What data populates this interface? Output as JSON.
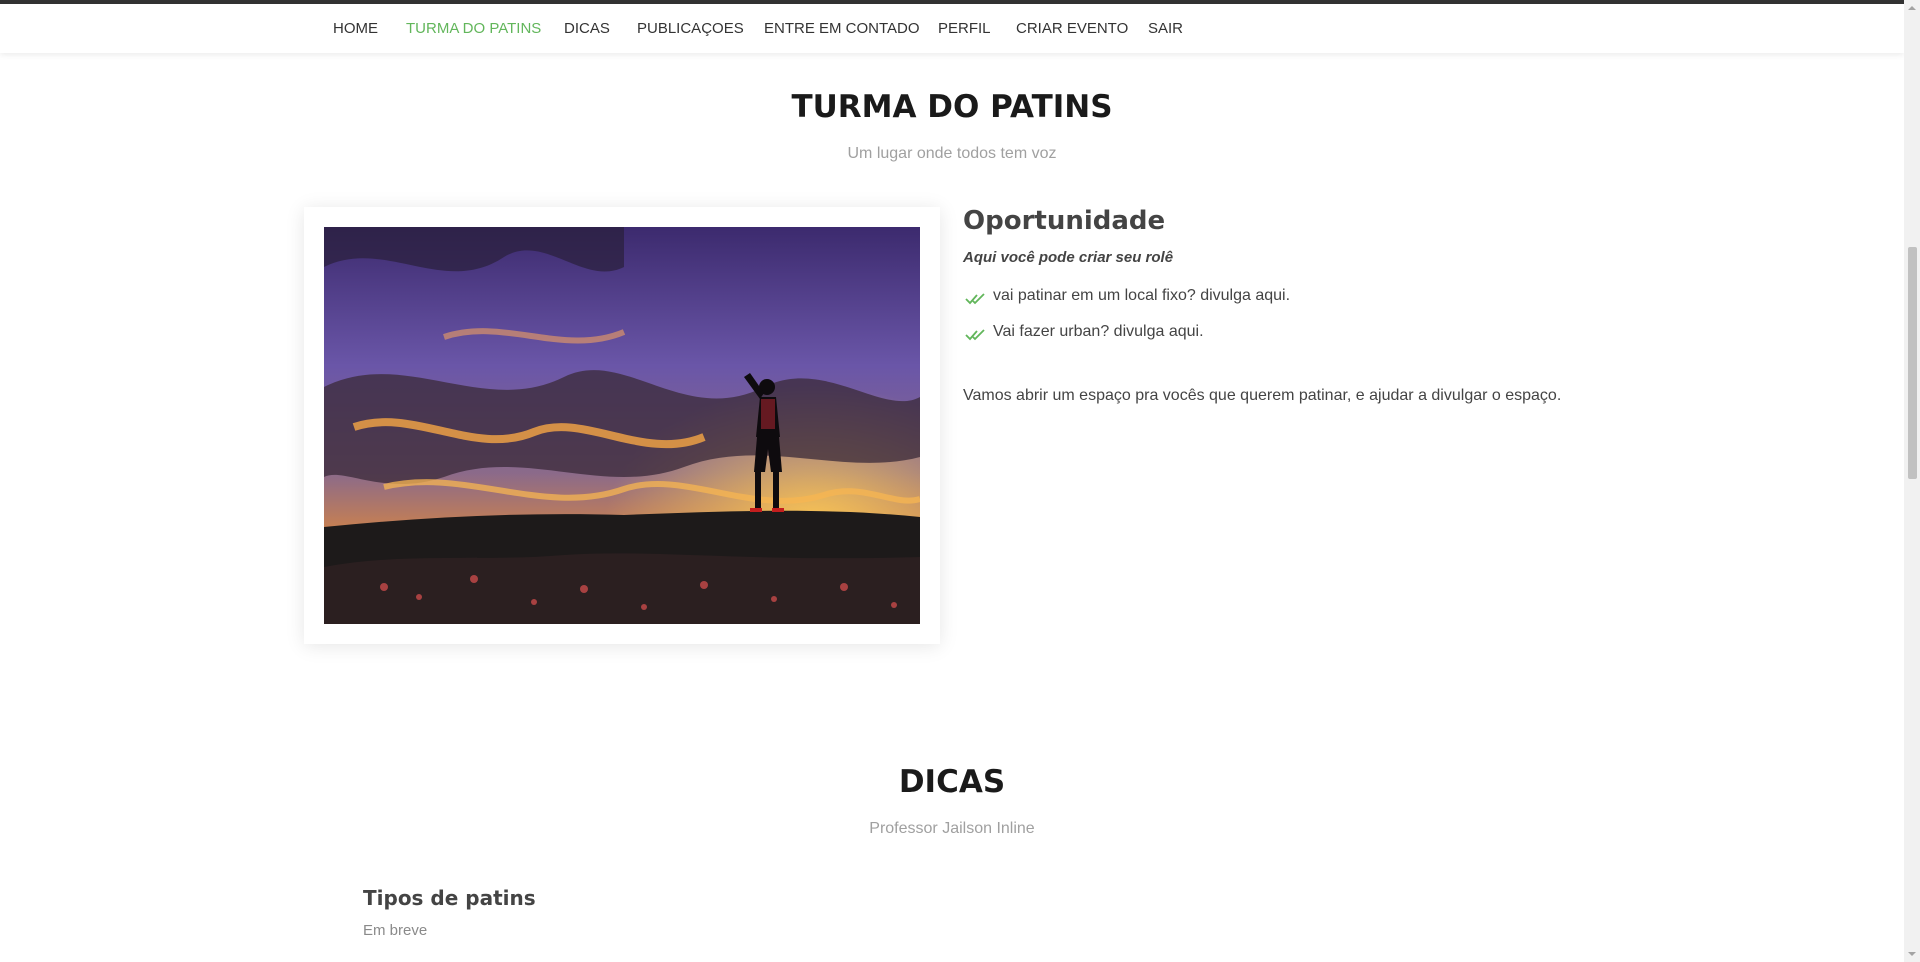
{
  "nav": {
    "items": [
      {
        "label": "HOME",
        "active": false
      },
      {
        "label": "TURMA DO PATINS",
        "active": true
      },
      {
        "label": "DICAS",
        "active": false
      },
      {
        "label": "PUBLICAÇOES",
        "active": false
      },
      {
        "label": "ENTRE EM CONTADO",
        "active": false
      },
      {
        "label": "PERFIL",
        "active": false
      },
      {
        "label": "CRIAR EVENTO",
        "active": false
      },
      {
        "label": "SAIR",
        "active": false
      }
    ]
  },
  "about": {
    "title": "TURMA DO PATINS",
    "subtitle": "Um lugar onde todos tem voz",
    "heading": "Oportunidade",
    "lead": "Aqui você pode criar seu rolê",
    "checks": [
      "vai patinar em um local fixo? divulga aqui.",
      "Vai fazer urban? divulga aqui."
    ],
    "paragraph": "Vamos abrir um espaço pra vocês que querem patinar, e ajudar a divulgar o espaço."
  },
  "tips": {
    "title": "DICAS",
    "subtitle": "Professor Jailson Inline",
    "item_title": "Tipos de patins",
    "item_text": "Em breve"
  },
  "colors": {
    "accent": "#62b65b",
    "text": "#444444",
    "muted": "#a0a0a0"
  },
  "icons": {
    "check": "double-check-icon"
  }
}
